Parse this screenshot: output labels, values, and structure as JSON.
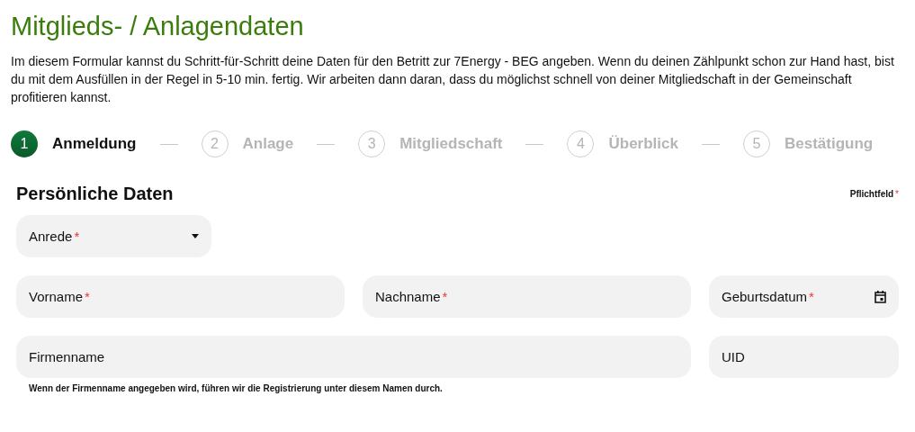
{
  "title": "Mitglieds- / Anlagendaten",
  "intro": "Im diesem Formular kannst du Schritt-für-Schritt deine Daten für den Betritt zur 7Energy - BEG angeben. Wenn du deinen Zählpunkt schon zur Hand hast, bist du mit dem Ausfüllen in der Regel in 5-10 min. fertig.  Wir arbeiten dann daran, dass du möglichst schnell von deiner Mitgliedschaft in der Gemeinschaft profitieren kannst.",
  "steps": [
    {
      "number": "1",
      "label": "Anmeldung",
      "selected": true
    },
    {
      "number": "2",
      "label": "Anlage",
      "selected": false
    },
    {
      "number": "3",
      "label": "Mitgliedschaft",
      "selected": false
    },
    {
      "number": "4",
      "label": "Überblick",
      "selected": false
    },
    {
      "number": "5",
      "label": "Bestätigung",
      "selected": false
    }
  ],
  "section": {
    "title": "Persönliche Daten",
    "required_note": "Pflichtfeld",
    "required_mark": "*"
  },
  "fields": [
    {
      "kind": "select",
      "label": "Anrede",
      "required": true
    },
    {
      "kind": "text",
      "label": "Vorname",
      "required": true
    },
    {
      "kind": "text",
      "label": "Nachname",
      "required": true
    },
    {
      "kind": "date",
      "label": "Geburtsdatum",
      "required": true
    },
    {
      "kind": "wide",
      "label": "Firmenname",
      "required": false
    },
    {
      "kind": "text",
      "label": "UID",
      "required": false
    }
  ],
  "hint": "Wenn der Firmenname angegeben wird, führen wir die Registrierung unter diesem Namen durch."
}
